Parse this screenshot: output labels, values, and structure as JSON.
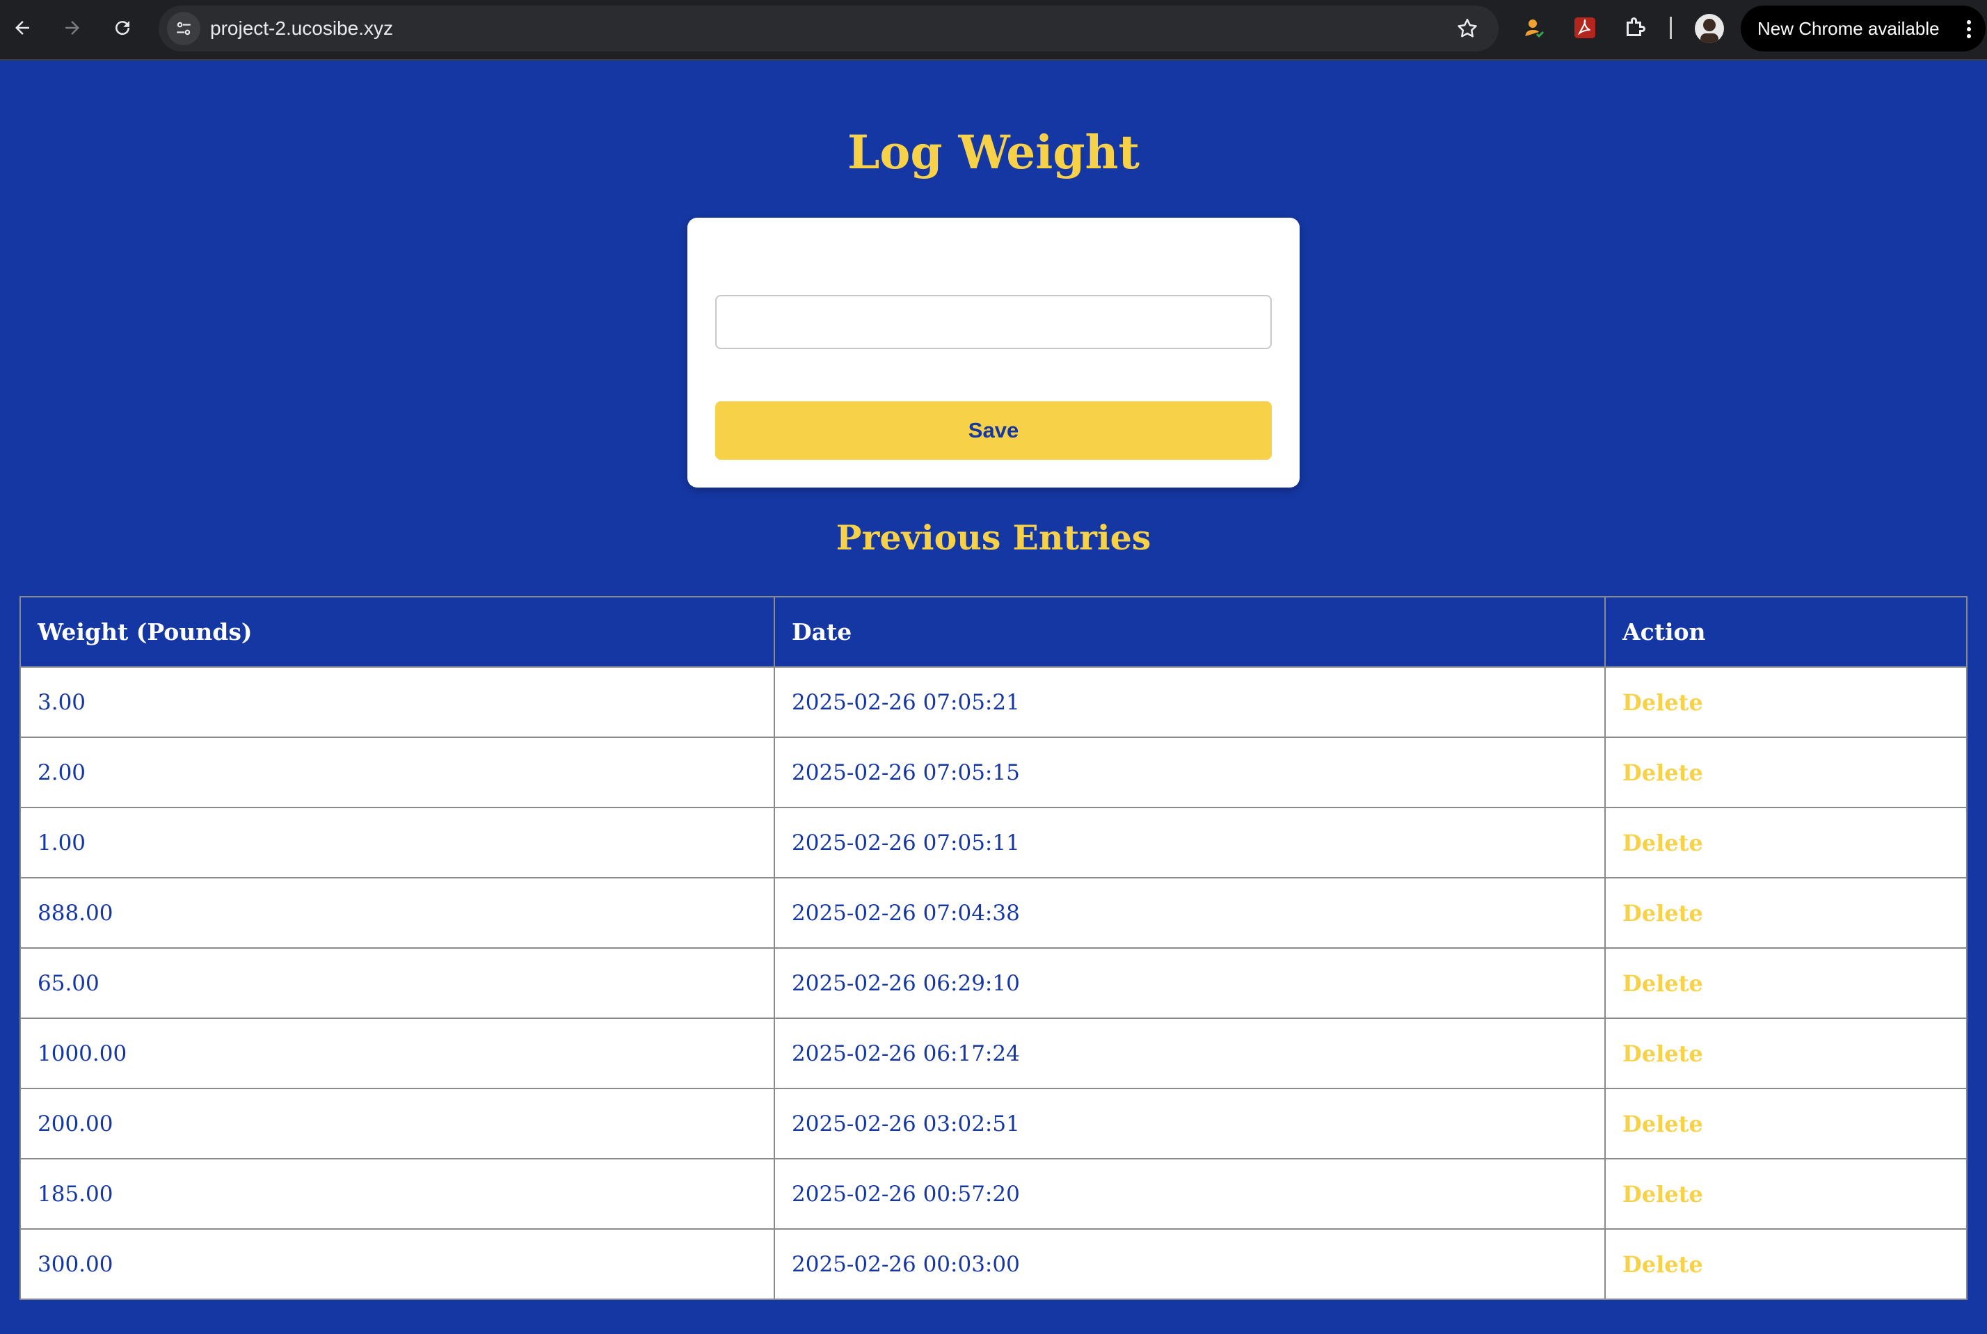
{
  "browser": {
    "url": "project-2.ucosibe.xyz",
    "update_label": "New Chrome available"
  },
  "page": {
    "title": "Log Weight",
    "input_value": "",
    "save_label": "Save",
    "entries_title": "Previous Entries"
  },
  "table": {
    "headers": [
      "Weight (Pounds)",
      "Date",
      "Action"
    ],
    "rows": [
      {
        "weight": "3.00",
        "date": "2025-02-26 07:05:21",
        "action": "Delete"
      },
      {
        "weight": "2.00",
        "date": "2025-02-26 07:05:15",
        "action": "Delete"
      },
      {
        "weight": "1.00",
        "date": "2025-02-26 07:05:11",
        "action": "Delete"
      },
      {
        "weight": "888.00",
        "date": "2025-02-26 07:04:38",
        "action": "Delete"
      },
      {
        "weight": "65.00",
        "date": "2025-02-26 06:29:10",
        "action": "Delete"
      },
      {
        "weight": "1000.00",
        "date": "2025-02-26 06:17:24",
        "action": "Delete"
      },
      {
        "weight": "200.00",
        "date": "2025-02-26 03:02:51",
        "action": "Delete"
      },
      {
        "weight": "185.00",
        "date": "2025-02-26 00:57:20",
        "action": "Delete"
      },
      {
        "weight": "300.00",
        "date": "2025-02-26 00:03:00",
        "action": "Delete"
      }
    ]
  },
  "colors": {
    "background": "#1537a3",
    "accent": "#f7d147",
    "card": "#ffffff"
  }
}
